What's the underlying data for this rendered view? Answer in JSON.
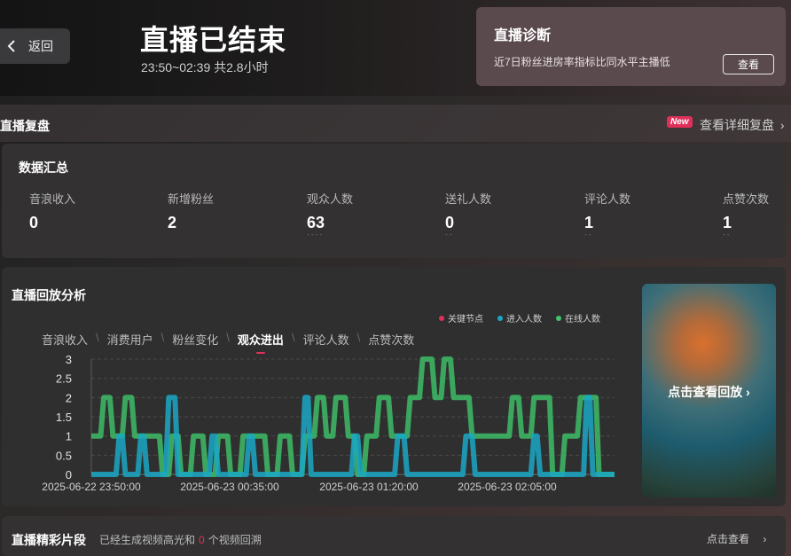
{
  "header": {
    "back_label": "返回",
    "title": "直播已结束",
    "time_range": "23:50~02:39 共2.8小时"
  },
  "diagnosis": {
    "title": "直播诊断",
    "description": "近7日粉丝进房率指标比同水平主播低",
    "button_label": "查看"
  },
  "review": {
    "section_title": "直播复盘",
    "new_badge": "New",
    "detail_link": "查看详细复盘"
  },
  "summary": {
    "title": "数据汇总",
    "stats": [
      {
        "label": "音浪收入",
        "value": "0"
      },
      {
        "label": "新增粉丝",
        "value": "2"
      },
      {
        "label": "观众人数",
        "value": "63"
      },
      {
        "label": "送礼人数",
        "value": "0"
      },
      {
        "label": "评论人数",
        "value": "1"
      },
      {
        "label": "点赞次数",
        "value": "1"
      }
    ]
  },
  "analysis": {
    "title": "直播回放分析",
    "legend": [
      {
        "label": "关键节点",
        "color": "#e0305a"
      },
      {
        "label": "进入人数",
        "color": "#1aa7c4"
      },
      {
        "label": "在线人数",
        "color": "#3ec46a"
      }
    ],
    "tabs": [
      {
        "label": "音浪收入",
        "active": false
      },
      {
        "label": "消费用户",
        "active": false
      },
      {
        "label": "粉丝变化",
        "active": false
      },
      {
        "label": "观众进出",
        "active": true
      },
      {
        "label": "评论人数",
        "active": false
      },
      {
        "label": "点赞次数",
        "active": false
      }
    ]
  },
  "chart_data": {
    "type": "line",
    "ylim": [
      0,
      3
    ],
    "yticks": [
      "0",
      "0.5",
      "1",
      "1.5",
      "2",
      "2.5",
      "3"
    ],
    "xticks": [
      "2025-06-22 23:50:00",
      "2025-06-23 00:35:00",
      "2025-06-23 01:20:00",
      "2025-06-23 02:05:00"
    ],
    "x_start": "2025-06-22 23:50:00",
    "x_end": "2025-06-23 02:39:00",
    "grid": true,
    "series": [
      {
        "name": "在线人数",
        "color": "#3ec46a",
        "x": [
          "23:50",
          "23:53",
          "23:54",
          "23:56",
          "23:57",
          "24:00",
          "24:01",
          "24:03",
          "24:04",
          "24:08",
          "24:09",
          "24:12",
          "24:13",
          "24:15",
          "24:16",
          "24:18",
          "24:19",
          "24:22",
          "24:23",
          "24:26",
          "24:27",
          "24:30",
          "24:31",
          "24:34",
          "24:35",
          "24:38",
          "24:39",
          "24:42",
          "24:43",
          "24:46",
          "24:47",
          "24:50",
          "24:51",
          "24:54",
          "24:55",
          "24:58",
          "24:59",
          "25:02",
          "25:03",
          "25:05",
          "25:06",
          "25:08",
          "25:09",
          "25:12",
          "25:13",
          "25:15",
          "25:16",
          "25:18",
          "25:19",
          "25:22",
          "25:23",
          "25:26",
          "25:27",
          "25:32",
          "25:33",
          "25:36",
          "25:37",
          "25:40",
          "25:41",
          "25:43",
          "25:44",
          "25:46",
          "25:47",
          "25:50",
          "25:51",
          "25:52",
          "25:53",
          "25:58",
          "25:59",
          "26:05",
          "26:06",
          "26:08",
          "26:09",
          "26:12",
          "26:13",
          "26:18",
          "26:19",
          "26:22",
          "26:23",
          "26:27",
          "26:28",
          "26:33",
          "26:34",
          "26:36",
          "26:37",
          "26:39"
        ],
        "y": [
          1,
          1,
          2,
          2,
          1,
          1,
          2,
          2,
          1,
          1,
          1,
          1,
          0,
          0,
          1,
          1,
          0,
          0,
          1,
          1,
          0,
          0,
          1,
          1,
          0,
          0,
          1,
          1,
          1,
          1,
          0,
          0,
          1,
          1,
          0,
          0,
          1,
          1,
          2,
          2,
          1,
          1,
          2,
          2,
          1,
          1,
          0,
          0,
          1,
          1,
          2,
          2,
          1,
          1,
          2,
          2,
          3,
          3,
          2,
          2,
          3,
          3,
          2,
          2,
          2,
          2,
          1,
          1,
          1,
          1,
          2,
          2,
          1,
          1,
          2,
          2,
          0,
          0,
          1,
          1,
          2,
          2,
          0,
          0,
          0,
          0
        ]
      },
      {
        "name": "进入人数",
        "color": "#1aa7c4",
        "x": [
          "23:50",
          "23:58",
          "23:59",
          "24:00",
          "24:01",
          "24:05",
          "24:06",
          "24:07",
          "24:08",
          "24:14",
          "24:15",
          "24:17",
          "24:18",
          "24:28",
          "24:29",
          "24:30",
          "24:31",
          "24:40",
          "24:41",
          "24:42",
          "24:43",
          "24:58",
          "24:59",
          "25:00",
          "25:01",
          "25:14",
          "25:15",
          "25:16",
          "25:17",
          "25:28",
          "25:29",
          "25:31",
          "25:32",
          "25:50",
          "25:51",
          "25:53",
          "25:54",
          "26:12",
          "26:13",
          "26:14",
          "26:15",
          "26:29",
          "26:30",
          "26:31",
          "26:32",
          "26:39"
        ],
        "y": [
          0,
          0,
          1,
          1,
          0,
          0,
          1,
          1,
          0,
          0,
          2,
          2,
          0,
          0,
          1,
          1,
          0,
          0,
          1,
          1,
          0,
          0,
          2,
          2,
          0,
          0,
          1,
          1,
          0,
          0,
          1,
          1,
          0,
          0,
          1,
          1,
          0,
          0,
          1,
          1,
          0,
          0,
          2,
          2,
          0,
          0
        ]
      }
    ]
  },
  "replay": {
    "label": "点击查看回放"
  },
  "clips": {
    "title": "直播精彩片段",
    "desc_prefix": "已经生成视频高光和",
    "count": "0",
    "desc_suffix": "个视频回溯",
    "link": "点击查看"
  }
}
